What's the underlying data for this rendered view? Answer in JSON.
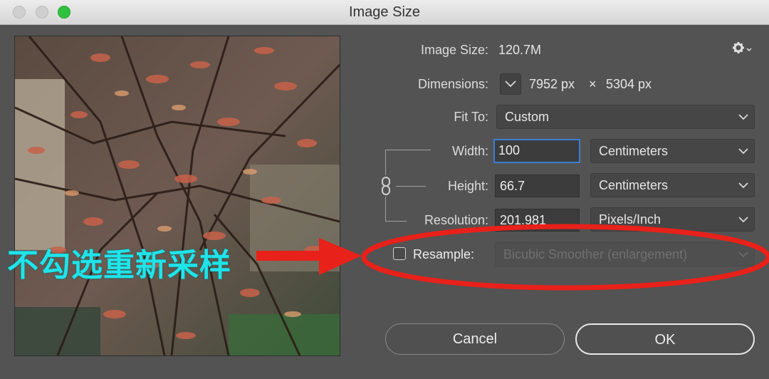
{
  "window": {
    "title": "Image Size",
    "traffic_lights": [
      "close",
      "minimize",
      "zoom"
    ],
    "accent_colors": {
      "zoom": "#2ec13f",
      "focus_ring": "#3b7fd4",
      "annotation_red": "#e8211a",
      "annotation_text": "#1fe4ea"
    }
  },
  "info": {
    "image_size_label": "Image Size:",
    "image_size_value": "120.7M",
    "settings_icon": "gear-icon",
    "dimensions_label": "Dimensions:",
    "dim_width": "7952 px",
    "dim_times": "×",
    "dim_height": "5304 px"
  },
  "fit_to": {
    "label": "Fit To:",
    "value": "Custom"
  },
  "width": {
    "label": "Width:",
    "value": "100",
    "unit": "Centimeters"
  },
  "height": {
    "label": "Height:",
    "value": "66.7",
    "unit": "Centimeters"
  },
  "resolution": {
    "label": "Resolution:",
    "value": "201.981",
    "unit": "Pixels/Inch"
  },
  "resample": {
    "label": "Resample:",
    "checked": false,
    "method": "Bicubic Smoother (enlargement)"
  },
  "buttons": {
    "cancel": "Cancel",
    "ok": "OK"
  },
  "annotation": {
    "text": "不勾选重新采样"
  }
}
